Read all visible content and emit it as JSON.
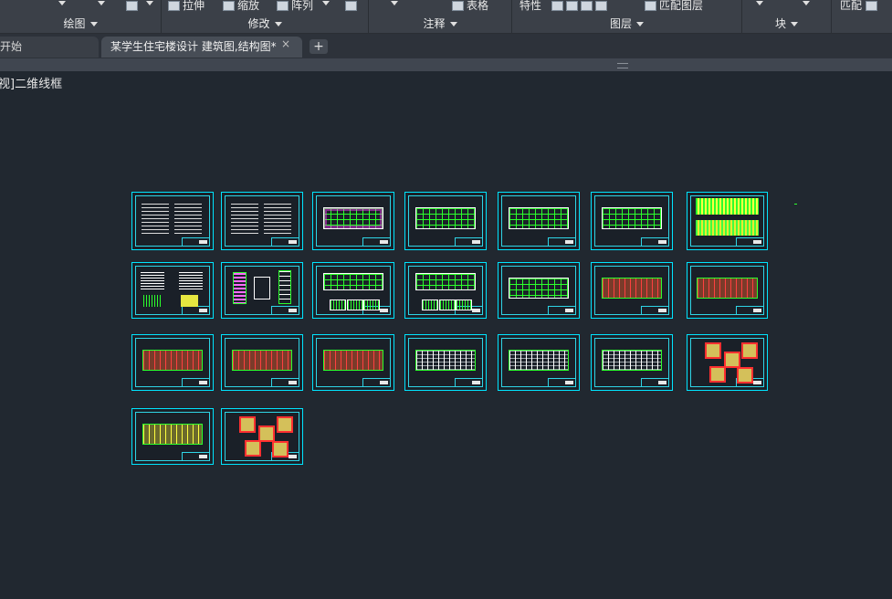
{
  "ribbon": {
    "tools": {
      "stretch": "拉伸",
      "scale": "缩放",
      "array": "阵列",
      "table": "表格",
      "properties": "特性",
      "match_layer": "匹配图层",
      "match": "匹配"
    },
    "panels": {
      "draw": "绘图",
      "modify": "修改",
      "annotate": "注释",
      "layers": "图层",
      "block": "块"
    }
  },
  "tabs": {
    "start": "开始",
    "drawing": "某学生住宅楼设计 建筑图,结构图*",
    "close_glyph": "×",
    "new_glyph": "+"
  },
  "viewport": {
    "label": "视]二维线框"
  },
  "colors": {
    "sheet_border": "#00e5ff",
    "line_green": "#2cff2c",
    "canvas": "#212830"
  },
  "sheets_count": 23
}
